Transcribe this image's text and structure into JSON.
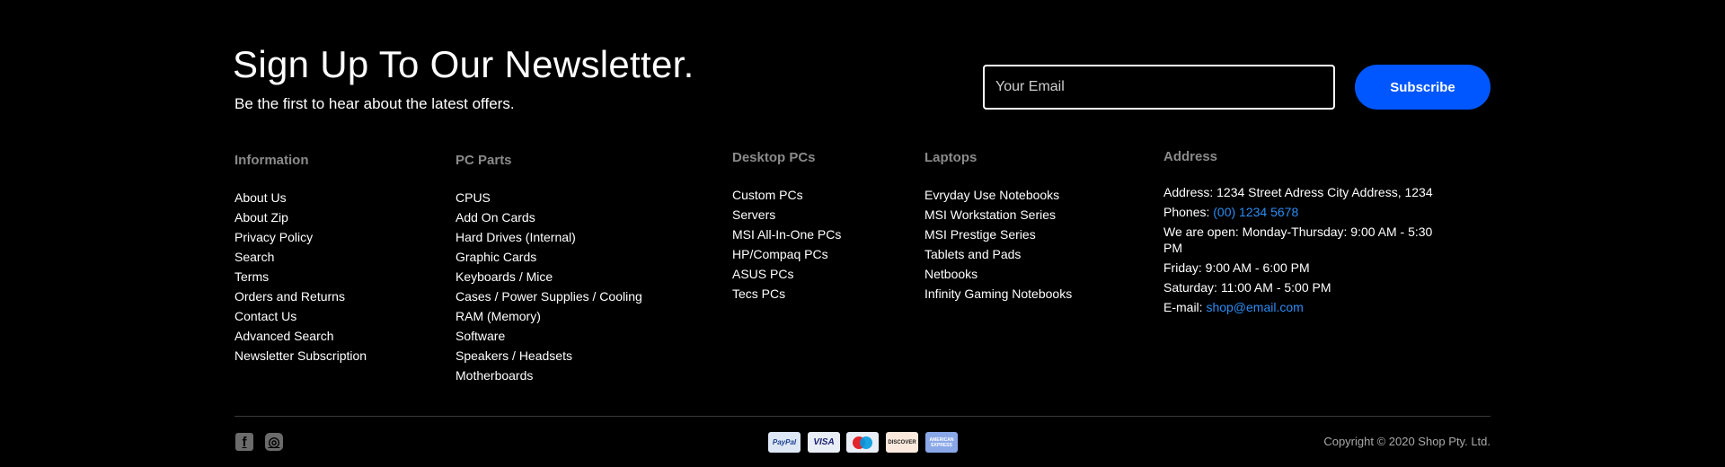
{
  "newsletter": {
    "title": "Sign Up To Our Newsletter.",
    "subtitle": "Be the first to hear about the latest offers.",
    "email_placeholder": "Your Email",
    "subscribe_label": "Subscribe"
  },
  "columns": {
    "information": {
      "heading": "Information",
      "items": [
        "About Us",
        "About Zip",
        "Privacy Policy",
        "Search",
        "Terms",
        "Orders and Returns",
        "Contact Us",
        "Advanced Search",
        "Newsletter Subscription"
      ]
    },
    "pc_parts": {
      "heading": "PC Parts",
      "items": [
        "CPUS",
        "Add On Cards",
        "Hard Drives (Internal)",
        "Graphic Cards",
        "Keyboards / Mice",
        "Cases / Power Supplies / Cooling",
        "RAM (Memory)",
        "Software",
        "Speakers / Headsets",
        "Motherboards"
      ]
    },
    "desktop_pcs": {
      "heading": "Desktop PCs",
      "items": [
        "Custom PCs",
        "Servers",
        "MSI All-In-One PCs",
        "HP/Compaq PCs",
        "ASUS PCs",
        "Tecs PCs"
      ]
    },
    "laptops": {
      "heading": "Laptops",
      "items": [
        "Evryday Use Notebooks",
        "MSI Workstation Series",
        "MSI Prestige Series",
        "Tablets and Pads",
        "Netbooks",
        "Infinity Gaming Notebooks"
      ]
    }
  },
  "address": {
    "heading": "Address",
    "address_line": "Address: 1234 Street Adress City Address, 1234",
    "phones_label": "Phones: ",
    "phone": "(00) 1234 5678",
    "hours_weekday": "We are open: Monday-Thursday: 9:00 AM - 5:30 PM",
    "hours_friday": "Friday: 9:00 AM - 6:00 PM",
    "hours_saturday": "Saturday: 11:00 AM - 5:00 PM",
    "email_label": "E-mail: ",
    "email": "shop@email.com"
  },
  "footer": {
    "social": [
      {
        "icon": "facebook-icon",
        "glyph": "f"
      },
      {
        "icon": "instagram-icon",
        "glyph": "◎"
      }
    ],
    "payments": [
      {
        "icon": "paypal-icon",
        "label": "PayPal",
        "bg": "#dde7f5",
        "fg": "#1d3f8f"
      },
      {
        "icon": "visa-icon",
        "label": "VISA",
        "bg": "#e9edf5",
        "fg": "#1a1f71"
      },
      {
        "icon": "maestro-icon",
        "label": "",
        "bg": "#e9edf5",
        "fg": "#000000"
      },
      {
        "icon": "discover-icon",
        "label": "DISCOVER",
        "bg": "#fce9dd",
        "fg": "#222222"
      },
      {
        "icon": "amex-icon",
        "label": "AMERICAN EXPRESS",
        "bg": "#8aa8e8",
        "fg": "#ffffff"
      }
    ],
    "copyright": "Copyright © 2020 Shop Pty. Ltd."
  },
  "colors": {
    "background": "#000000",
    "accent": "#0057ff",
    "link": "#2c8cf5",
    "heading_gray": "#8a8a8a"
  }
}
